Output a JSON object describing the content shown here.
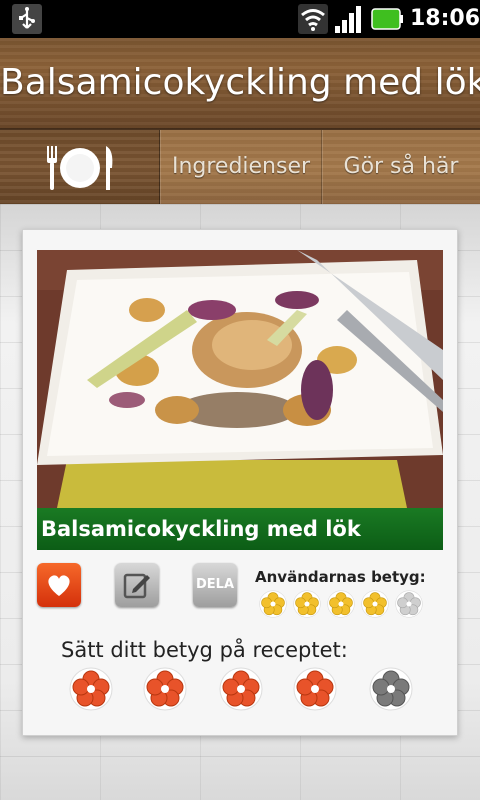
{
  "status_bar": {
    "time": "18:06",
    "icons": [
      "usb-icon",
      "wifi-icon",
      "signal-icon",
      "battery-icon"
    ],
    "battery_color": "#3fbf1f"
  },
  "header": {
    "title": "Balsamicokyckling med lök"
  },
  "tabs": [
    {
      "label": "Ingredienser"
    },
    {
      "label": "Gör så här"
    }
  ],
  "recipe": {
    "name": "Balsamicokyckling med lök",
    "share_label": "DELA",
    "users_rating_label": "Användarnas betyg:",
    "users_rating": 4,
    "users_rating_max": 5,
    "rate_prompt": "Sätt ditt betyg på receptet:",
    "rate_options": 5,
    "my_rating": 4
  },
  "colors": {
    "name_bar": "#0c5d16",
    "favorite_button": "#e2461a",
    "active_flower": "#e8532a",
    "inactive_flower": "#7a7a7a",
    "small_active_flower": "#f2c02c"
  }
}
